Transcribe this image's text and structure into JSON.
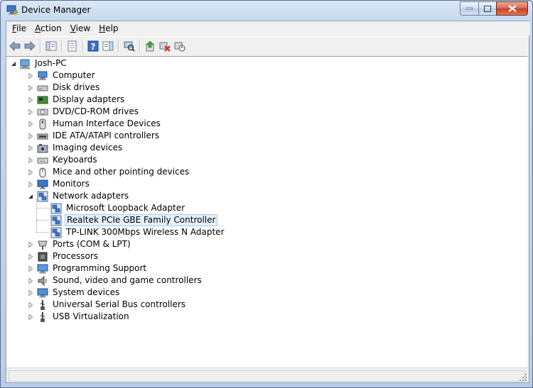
{
  "window": {
    "title": "Device Manager"
  },
  "menubar": [
    {
      "key": "F",
      "rest": "ile"
    },
    {
      "key": "A",
      "rest": "ction"
    },
    {
      "key": "V",
      "rest": "iew"
    },
    {
      "key": "H",
      "rest": "elp"
    }
  ],
  "toolbar": [
    {
      "name": "back-button-icon",
      "icon": "arrow-left"
    },
    {
      "name": "forward-button-icon",
      "icon": "arrow-right"
    },
    {
      "name": "show-hide-console-tree-icon",
      "icon": "console-tree"
    },
    {
      "name": "properties-icon",
      "icon": "properties"
    },
    {
      "name": "help-icon",
      "icon": "help"
    },
    {
      "name": "show-hide-action-pane-icon",
      "icon": "action-pane"
    },
    {
      "name": "scan-hardware-changes-icon",
      "icon": "scan"
    },
    {
      "name": "update-driver-icon",
      "icon": "update-driver"
    },
    {
      "name": "uninstall-icon",
      "icon": "uninstall"
    },
    {
      "name": "disable-icon",
      "icon": "disable"
    }
  ],
  "tree": {
    "root": {
      "label": "Josh-PC",
      "icon": "computer-root"
    },
    "categories": [
      {
        "label": "Computer",
        "icon": "computer-icon"
      },
      {
        "label": "Disk drives",
        "icon": "disk-drive-icon"
      },
      {
        "label": "Display adapters",
        "icon": "display-adapter-icon"
      },
      {
        "label": "DVD/CD-ROM drives",
        "icon": "dvd-drive-icon"
      },
      {
        "label": "Human Interface Devices",
        "icon": "hid-icon"
      },
      {
        "label": "IDE ATA/ATAPI controllers",
        "icon": "ide-controller-icon"
      },
      {
        "label": "Imaging devices",
        "icon": "imaging-device-icon"
      },
      {
        "label": "Keyboards",
        "icon": "keyboard-icon"
      },
      {
        "label": "Mice and other pointing devices",
        "icon": "mouse-icon"
      },
      {
        "label": "Monitors",
        "icon": "monitor-icon"
      },
      {
        "label": "Network adapters",
        "icon": "network-adapter-icon",
        "expanded": true,
        "children": [
          {
            "label": "Microsoft Loopback Adapter",
            "icon": "network-adapter-icon"
          },
          {
            "label": "Realtek PCIe GBE Family Controller",
            "icon": "network-adapter-icon",
            "selected": true
          },
          {
            "label": "TP-LINK 300Mbps Wireless N Adapter",
            "icon": "network-adapter-icon"
          }
        ]
      },
      {
        "label": "Ports (COM & LPT)",
        "icon": "port-icon"
      },
      {
        "label": "Processors",
        "icon": "processor-icon"
      },
      {
        "label": "Programming Support",
        "icon": "programming-support-icon"
      },
      {
        "label": "Sound, video and game controllers",
        "icon": "sound-icon"
      },
      {
        "label": "System devices",
        "icon": "system-device-icon"
      },
      {
        "label": "Universal Serial Bus controllers",
        "icon": "usb-icon"
      },
      {
        "label": "USB Virtualization",
        "icon": "usb-icon"
      }
    ]
  },
  "colors": {
    "selection_bg": "#e5f1fb",
    "selection_border": "#a6cbea",
    "close_button": "#c6401f"
  }
}
